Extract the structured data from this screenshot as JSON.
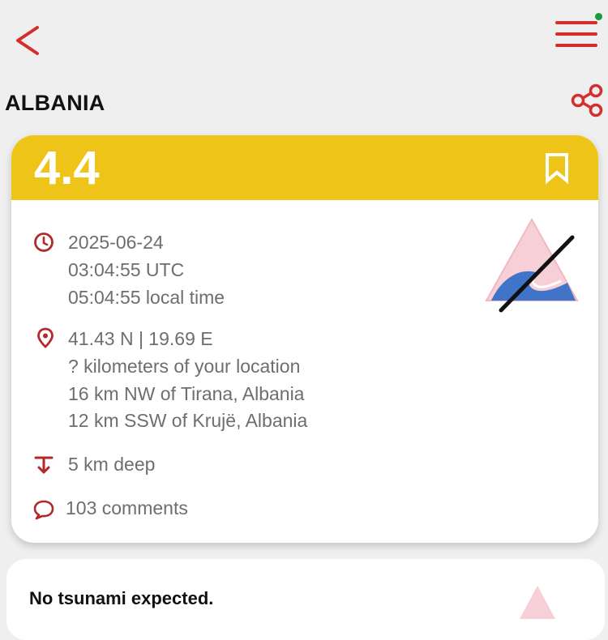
{
  "header": {
    "back_icon": "chevron-left-icon",
    "menu_icon": "hamburger-menu-icon",
    "accent_color": "#d32f2f"
  },
  "region": {
    "title": "ALBANIA",
    "share_icon": "share-icon"
  },
  "event": {
    "magnitude": "4.4",
    "header_color": "#eec418",
    "bookmark_icon": "bookmark-icon",
    "date": "2025-06-24",
    "time_utc": "03:04:55 UTC",
    "time_local": "05:04:55 local time",
    "coordinates": "41.43 N | 19.69 E",
    "distance_from_user": "? kilometers of your location",
    "nearby_1": "16 km NW of Tirana, Albania",
    "nearby_2": "12 km SSW of Krujë, Albania",
    "depth": "5 km deep",
    "comments": "103 comments",
    "tsunami_icon": "no-tsunami-icon"
  },
  "tsunami_card": {
    "message": "No tsunami expected."
  }
}
